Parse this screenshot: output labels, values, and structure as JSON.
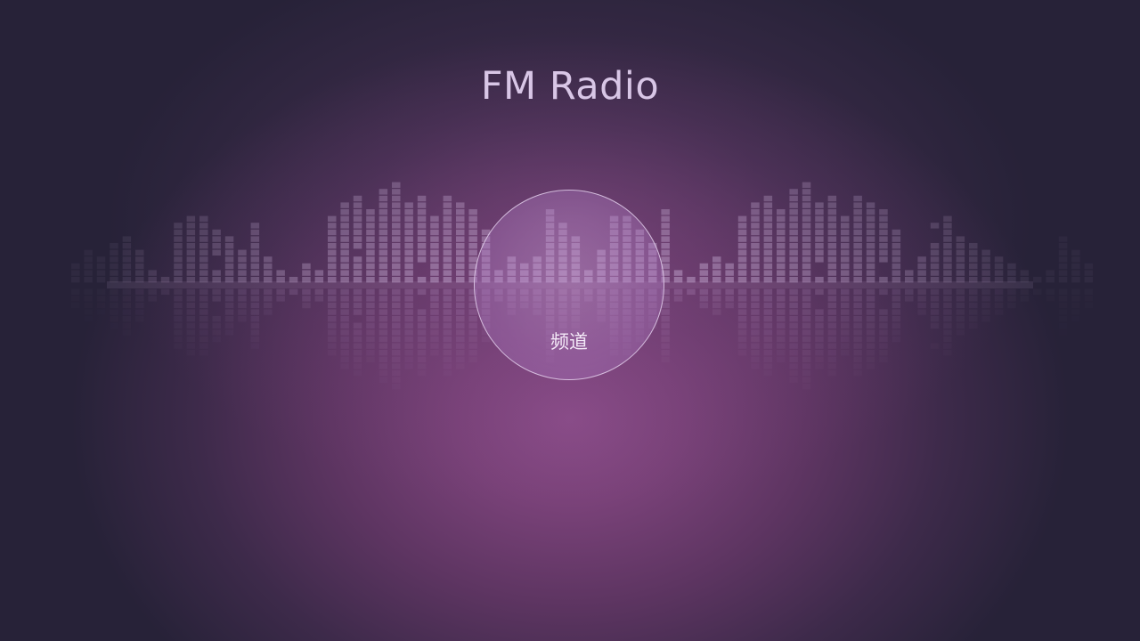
{
  "app": {
    "title": "FM Radio"
  },
  "channel_button": {
    "label": "频道"
  },
  "equalizer": {
    "bar_color": "#d7bfe6",
    "reflection_color": "#c9a6d8",
    "levels": [
      3,
      5,
      4,
      6,
      7,
      5,
      2,
      1,
      9,
      10,
      10,
      8,
      7,
      5,
      9,
      4,
      2,
      1,
      3,
      2,
      10,
      12,
      13,
      11,
      14,
      15,
      12,
      13,
      10,
      13,
      12,
      11,
      8,
      2,
      4,
      3,
      4,
      11,
      9,
      7,
      2,
      5,
      10,
      10,
      8,
      6,
      11,
      2,
      1,
      3,
      4,
      3,
      10,
      12,
      13,
      11,
      14,
      15,
      12,
      13,
      10,
      13,
      12,
      11,
      8,
      2,
      4,
      9,
      10,
      7,
      6,
      5,
      4,
      3,
      2,
      1,
      2,
      7,
      5,
      3
    ],
    "gaps": [
      [
        11,
        2
      ],
      [
        11,
        3
      ],
      [
        27,
        1
      ],
      [
        27,
        2
      ],
      [
        22,
        4
      ],
      [
        58,
        1
      ],
      [
        58,
        2
      ],
      [
        63,
        1
      ],
      [
        63,
        2
      ],
      [
        67,
        6
      ],
      [
        67,
        7
      ]
    ]
  },
  "colors": {
    "background_center": "#8c4d8a",
    "background_edge": "#232036",
    "title_text": "#d8c6e6",
    "button_border": "#eedef6"
  }
}
